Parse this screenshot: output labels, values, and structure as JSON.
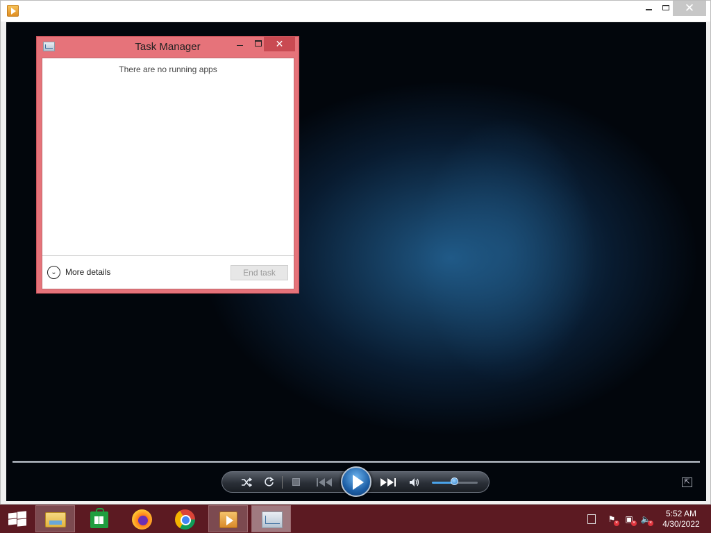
{
  "media_player": {
    "window_controls": {
      "minimize": "—",
      "maximize": "☐",
      "close": "✕"
    },
    "controls": {
      "shuffle_icon": "shuffle-icon",
      "repeat_icon": "repeat-icon",
      "stop_icon": "stop-icon",
      "previous_icon": "previous-icon",
      "play_icon": "play-icon",
      "next_icon": "next-icon",
      "volume_icon": "volume-icon",
      "volume_level": 0.5,
      "switch_view_icon": "switch-to-library-icon"
    }
  },
  "task_manager": {
    "title": "Task Manager",
    "close_symbol": "✕",
    "empty_message": "There are no running apps",
    "more_details_label": "More details",
    "end_task_label": "End task",
    "accent_color": "#e6737a"
  },
  "taskbar": {
    "accent_color": "#5c1a22",
    "pinned": [
      {
        "name": "File Explorer",
        "icon": "folder-icon"
      },
      {
        "name": "Store",
        "icon": "store-icon"
      },
      {
        "name": "Firefox",
        "icon": "firefox-icon"
      },
      {
        "name": "Google Chrome",
        "icon": "chrome-icon"
      },
      {
        "name": "Windows Media Player",
        "icon": "media-player-icon"
      },
      {
        "name": "Task Manager",
        "icon": "task-manager-icon"
      }
    ],
    "tray": {
      "icons": [
        "show-desktop-icon",
        "action-center-flag-icon",
        "network-icon",
        "volume-muted-icon"
      ],
      "time": "5:52 AM",
      "date": "4/30/2022"
    }
  }
}
